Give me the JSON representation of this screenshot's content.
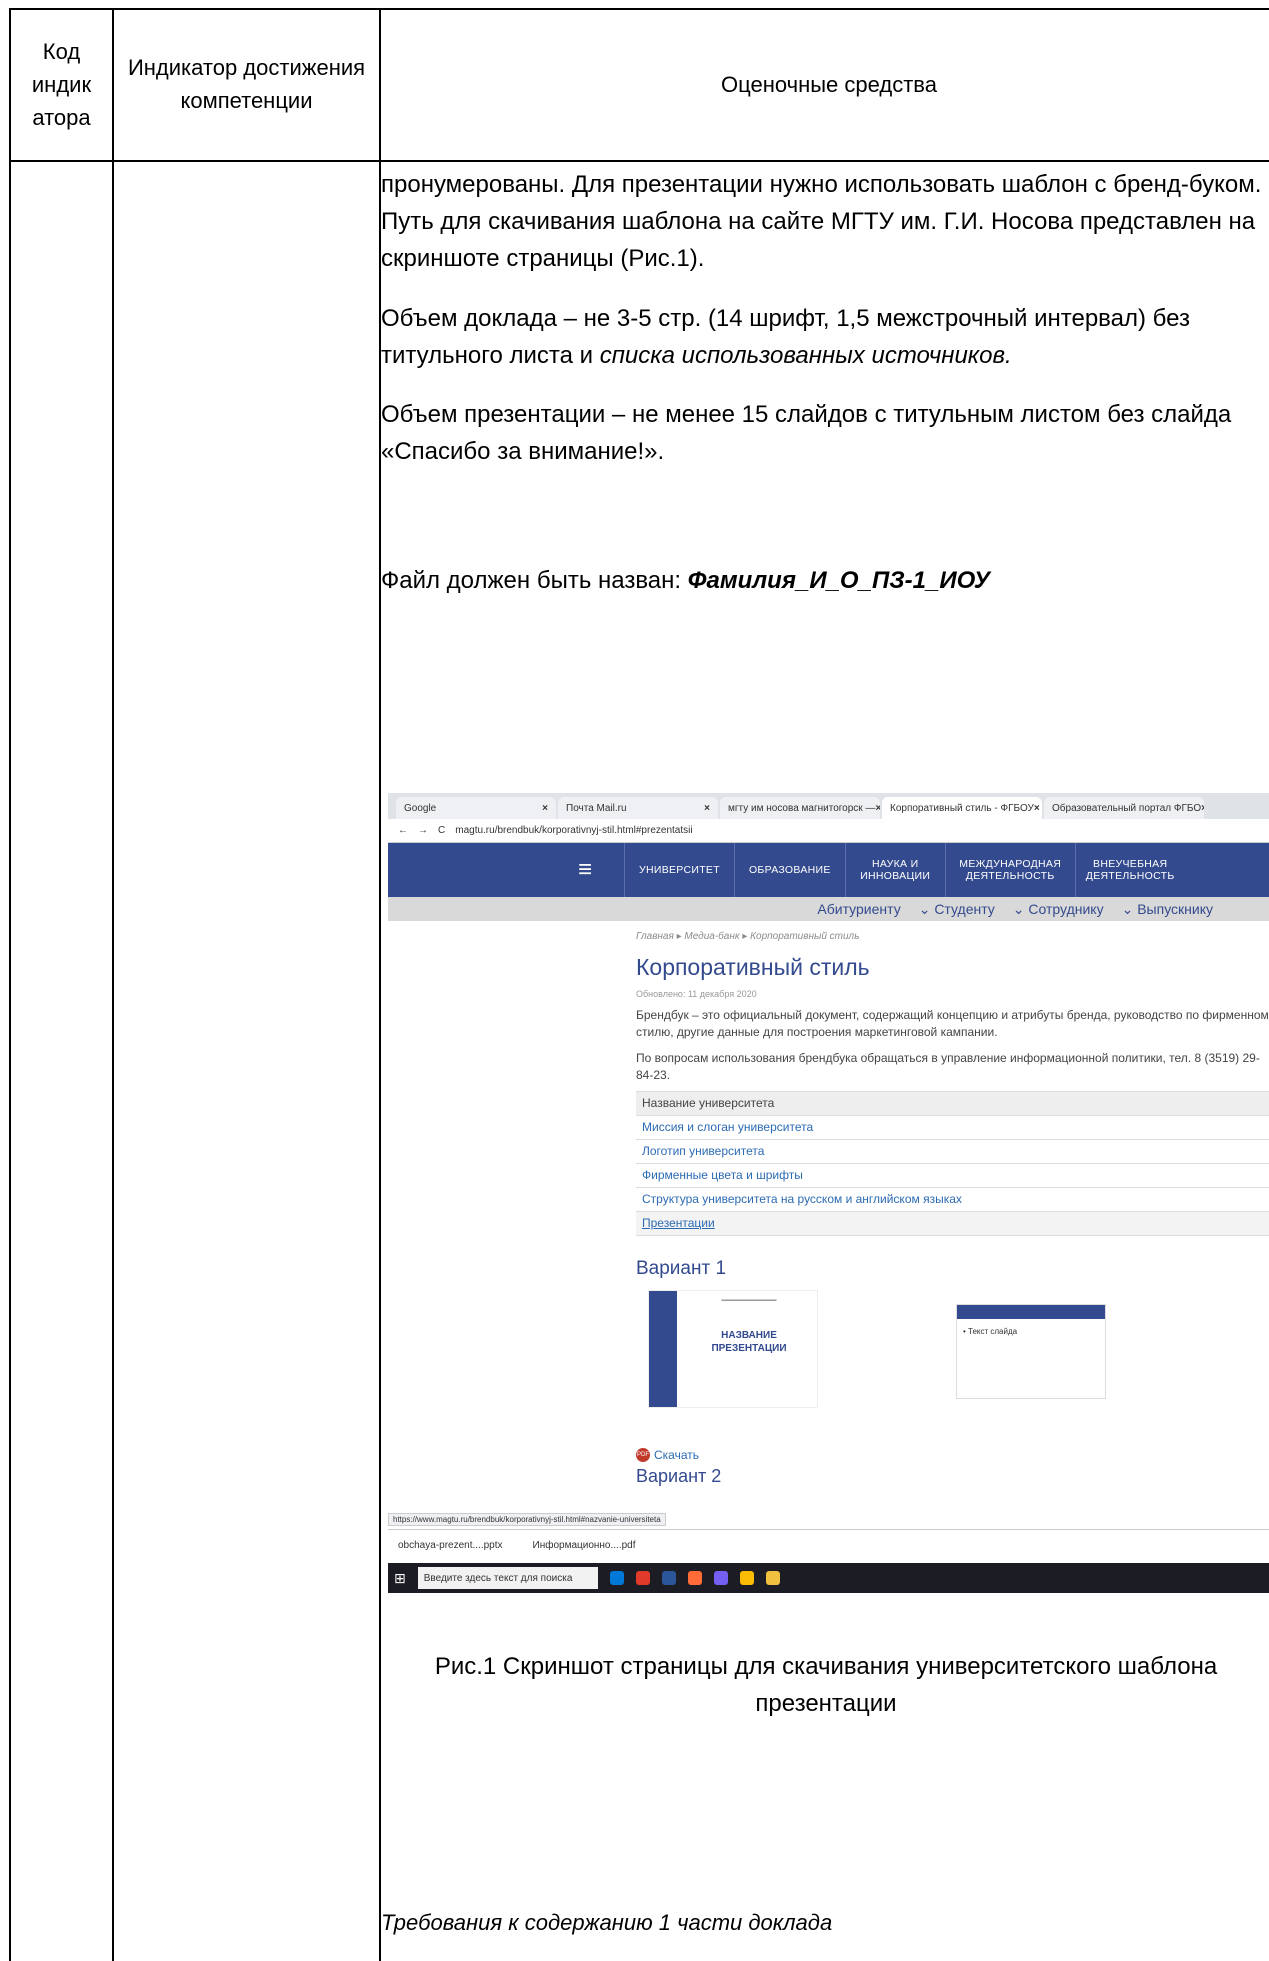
{
  "table": {
    "headers": {
      "code": "Код индик атора",
      "indicator": "Индикатор достижения компетенции",
      "means": "Оценочные средства"
    }
  },
  "body": {
    "p1": "пронумерованы. Для презентации нужно использовать шаблон с бренд-буком. Путь для скачивания шаблона на сайте МГТУ им. Г.И. Носова представлен на скриншоте страницы (Рис.1).",
    "p2_prefix": "Объем доклада – не 3-5 стр. (14 шрифт, 1,5 межстрочный интервал) без титульного листа и ",
    "p2_italic": "списка использованных источников.",
    "p3": "Объем презентации – не менее 15 слайдов с титульным листом без слайда «Спасибо за внимание!».",
    "p4_prefix": "Файл должен быть назван: ",
    "p4_filename": "Фамилия_И_О_ПЗ-1_ИОУ"
  },
  "screenshot": {
    "tabs": [
      "Google",
      "Почта Mail.ru",
      "мгту им носова магнитогорск —",
      "Корпоративный стиль - ФГБОУ",
      "Образовательный портал ФГБО"
    ],
    "address": "magtu.ru/brendbuk/korporativnyj-stil.html#prezentatsii",
    "nav": [
      "УНИВЕРСИТЕТ",
      "ОБРАЗОВАНИЕ",
      "НАУКА И ИННОВАЦИИ",
      "МЕЖДУНАРОДНАЯ ДЕЯТЕЛЬНОСТЬ",
      "ВНЕУЧЕБНАЯ ДЕЯТЕЛЬНОСТЬ"
    ],
    "subnav": [
      "Абитуриенту",
      "⌄ Студенту",
      "⌄ Сотруднику",
      "⌄ Выпускнику"
    ],
    "breadcrumbs": "Главная ▸ Медиа-банк ▸ Корпоративный стиль",
    "page_title": "Корпоративный стиль",
    "updated": "Обновлено: 11 декабря 2020",
    "desc1": "Брендбук – это официальный документ, содержащий концепцию и атрибуты бренда, руководство по фирменному стилю, другие данные для построения маркетинговой кампании.",
    "desc2": "По вопросам использования брендбука обращаться в управление информационной политики, тел. 8 (3519) 29-84-23.",
    "accordion": [
      "Название университета",
      "Миссия и слоган университета",
      "Логотип университета",
      "Фирменные цвета и шрифты",
      "Структура университета на русском и английском языках",
      "Презентации"
    ],
    "variant1": "Вариант 1",
    "slide_title": "НАЗВАНИЕ ПРЕЗЕНТАЦИИ",
    "slide_text": "• Текст слайда",
    "download": "Скачать",
    "variant2": "Вариант 2",
    "status_url": "https://www.magtu.ru/brendbuk/korporativnyj-stil.html#nazvanie-universiteta",
    "downloads": [
      "obchaya-prezent....pptx",
      "Информационно....pdf"
    ],
    "search_placeholder": "Введите здесь текст для поиска"
  },
  "caption": "Рис.1 Скриншот страницы для скачивания университетского шаблона презентации",
  "requirements": "Требования к содержанию 1 части доклада"
}
